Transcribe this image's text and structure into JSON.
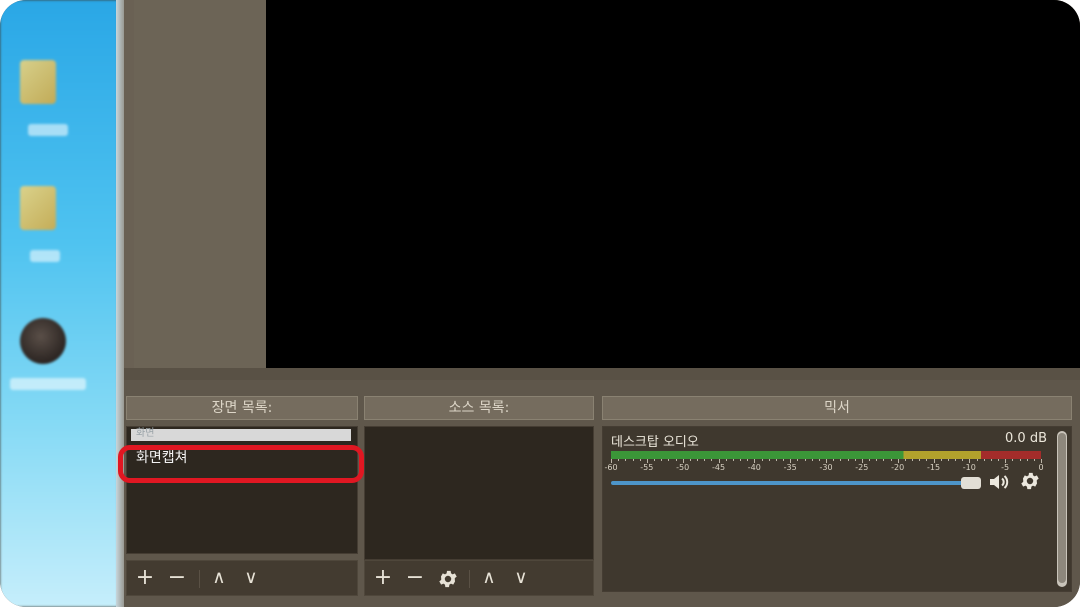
{
  "scene_list": {
    "title": "장면 목록:",
    "items": [
      {
        "label": "화면"
      },
      {
        "label": "화면캡쳐"
      }
    ],
    "toolbar": {
      "add": "+",
      "remove": "−",
      "up": "∧",
      "down": "∨"
    }
  },
  "source_list": {
    "title": "소스 목록:",
    "toolbar": {
      "add": "+",
      "remove": "−",
      "up": "∧",
      "down": "∨"
    }
  },
  "mixer": {
    "title": "믹서",
    "channel_name": "데스크탑 오디오",
    "db_readout": "0.0 dB",
    "meter_labels": [
      "-60",
      "-55",
      "-50",
      "-45",
      "-40",
      "-35",
      "-30",
      "-25",
      "-20",
      "-15",
      "-10",
      "-5",
      "0"
    ],
    "volume_level": 1.0
  },
  "colors": {
    "highlight": "#e01722",
    "meter_green": "#3aa63a",
    "meter_yellow": "#c7b52c",
    "meter_red": "#b52a2a",
    "volume_blue": "#4d95c9"
  },
  "icons": {
    "speaker": "speaker-icon",
    "settings": "gear-icon"
  }
}
